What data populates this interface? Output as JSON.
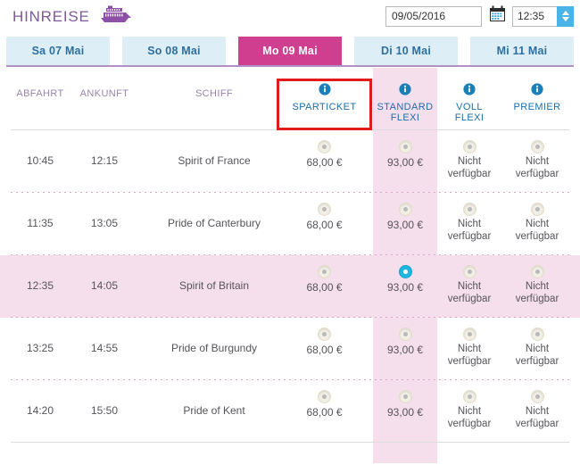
{
  "header": {
    "title": "HINREISE",
    "ship_icon": "ferry-icon",
    "date_value": "09/05/2016",
    "date_placeholder": "TT/MM/JJJJ",
    "calendar_icon": "calendar-icon",
    "time_value": "12:35",
    "time_placeholder": "HH:MM",
    "spinner_up_icon": "chevron-up-icon",
    "spinner_down_icon": "chevron-down-icon"
  },
  "tabs": [
    {
      "label": "Sa 07 Mai",
      "active": false
    },
    {
      "label": "So 08 Mai",
      "active": false
    },
    {
      "label": "Mo 09 Mai",
      "active": true
    },
    {
      "label": "Di 10 Mai",
      "active": false
    },
    {
      "label": "Mi 11 Mai",
      "active": false
    }
  ],
  "table": {
    "columns": {
      "departure": "ABFAHRT",
      "arrival": "ANKUNFT",
      "ship": "SCHIFF",
      "fares": [
        {
          "label": "SPARTICKET",
          "line2": "",
          "info_icon": "info-icon",
          "highlighted": false,
          "annotated": true
        },
        {
          "label": "STANDARD",
          "line2": "FLEXI",
          "info_icon": "info-icon",
          "highlighted": true,
          "annotated": false
        },
        {
          "label": "VOLL",
          "line2": "FLEXI",
          "info_icon": "info-icon",
          "highlighted": false,
          "annotated": false
        },
        {
          "label": "PREMIER",
          "line2": "",
          "info_icon": "info-icon",
          "highlighted": false,
          "annotated": false
        }
      ]
    },
    "unavailable_label_line1": "Nicht",
    "unavailable_label_line2": "verfügbar",
    "rows": [
      {
        "departure": "10:45",
        "arrival": "12:15",
        "ship": "Spirit of France",
        "selected": false,
        "fares": [
          {
            "price": "68,00 €",
            "available": true,
            "checked": false
          },
          {
            "price": "93,00 €",
            "available": true,
            "checked": false
          },
          {
            "price": "",
            "available": false,
            "checked": false
          },
          {
            "price": "",
            "available": false,
            "checked": false
          }
        ]
      },
      {
        "departure": "11:35",
        "arrival": "13:05",
        "ship": "Pride of Canterbury",
        "selected": false,
        "fares": [
          {
            "price": "68,00 €",
            "available": true,
            "checked": false
          },
          {
            "price": "93,00 €",
            "available": true,
            "checked": false
          },
          {
            "price": "",
            "available": false,
            "checked": false
          },
          {
            "price": "",
            "available": false,
            "checked": false
          }
        ]
      },
      {
        "departure": "12:35",
        "arrival": "14:05",
        "ship": "Spirit of Britain",
        "selected": true,
        "fares": [
          {
            "price": "68,00 €",
            "available": true,
            "checked": false
          },
          {
            "price": "93,00 €",
            "available": true,
            "checked": true
          },
          {
            "price": "",
            "available": false,
            "checked": false
          },
          {
            "price": "",
            "available": false,
            "checked": false
          }
        ]
      },
      {
        "departure": "13:25",
        "arrival": "14:55",
        "ship": "Pride of Burgundy",
        "selected": false,
        "fares": [
          {
            "price": "68,00 €",
            "available": true,
            "checked": false
          },
          {
            "price": "93,00 €",
            "available": true,
            "checked": false
          },
          {
            "price": "",
            "available": false,
            "checked": false
          },
          {
            "price": "",
            "available": false,
            "checked": false
          }
        ]
      },
      {
        "departure": "14:20",
        "arrival": "15:50",
        "ship": "Pride of Kent",
        "selected": false,
        "fares": [
          {
            "price": "68,00 €",
            "available": true,
            "checked": false
          },
          {
            "price": "93,00 €",
            "available": true,
            "checked": false
          },
          {
            "price": "",
            "available": false,
            "checked": false
          },
          {
            "price": "",
            "available": false,
            "checked": false
          }
        ]
      }
    ]
  },
  "annotation": {
    "target": "SPARTICKET",
    "box_color": "#e31a1a"
  },
  "colors": {
    "brand_purple": "#7d5a96",
    "tab_inactive_bg": "#ddeef7",
    "tab_inactive_text": "#2e6f9e",
    "tab_active_bg": "#cf3e8f",
    "highlight_column": "#f6dfec",
    "fare_header_text": "#1a6fa8",
    "info_icon": "#1a7fb8",
    "radio_checked": "#1fb6e0",
    "spinner_blue": "#4ab4e6"
  }
}
